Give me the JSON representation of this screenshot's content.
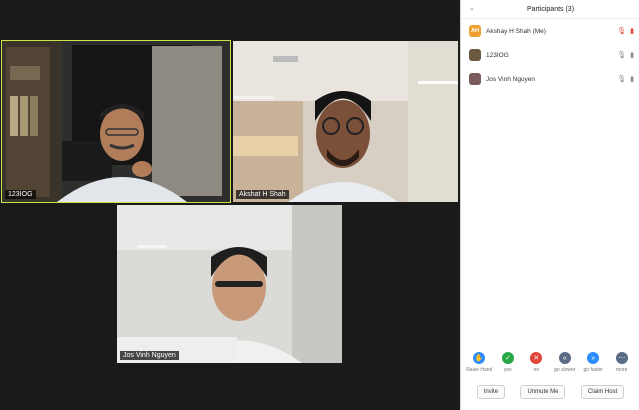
{
  "colors": {
    "active_speaker": "#c8e64c",
    "raise": "#2d8cff",
    "yes": "#27a844",
    "no": "#e0453a",
    "neutral": "#5a6b86"
  },
  "videos": [
    {
      "name": "123IOG",
      "active": true
    },
    {
      "name": "Akshat H Shah"
    },
    {
      "name": "Jos Vinh Nguyen"
    }
  ],
  "participants_panel": {
    "title": "Participants (3)",
    "participants": [
      {
        "initials": "AH",
        "name": "Akshay H Shah (Me)",
        "avatar_color": "#f0a030",
        "mic": "muted",
        "video": "off"
      },
      {
        "initials": "",
        "name": "123IOG",
        "avatar_color": "#6b5a40",
        "mic": "on",
        "video": "on"
      },
      {
        "initials": "",
        "name": "Jos Vinh Nguyen",
        "avatar_color": "#7a5c5c",
        "mic": "on",
        "video": "on"
      }
    ],
    "reactions": [
      {
        "icon": "raise-hand-icon",
        "label": "Raise Hand",
        "glyph": "✋"
      },
      {
        "icon": "yes-icon",
        "label": "yes",
        "glyph": "✓"
      },
      {
        "icon": "no-icon",
        "label": "no",
        "glyph": "✕"
      },
      {
        "icon": "go-slower-icon",
        "label": "go slower",
        "glyph": "«"
      },
      {
        "icon": "go-faster-icon",
        "label": "go faster",
        "glyph": "»"
      },
      {
        "icon": "more-icon",
        "label": "more",
        "glyph": "⋯"
      }
    ],
    "buttons": {
      "invite": "Invite",
      "unmute": "Unmute Me",
      "claim_host": "Claim Host"
    }
  }
}
